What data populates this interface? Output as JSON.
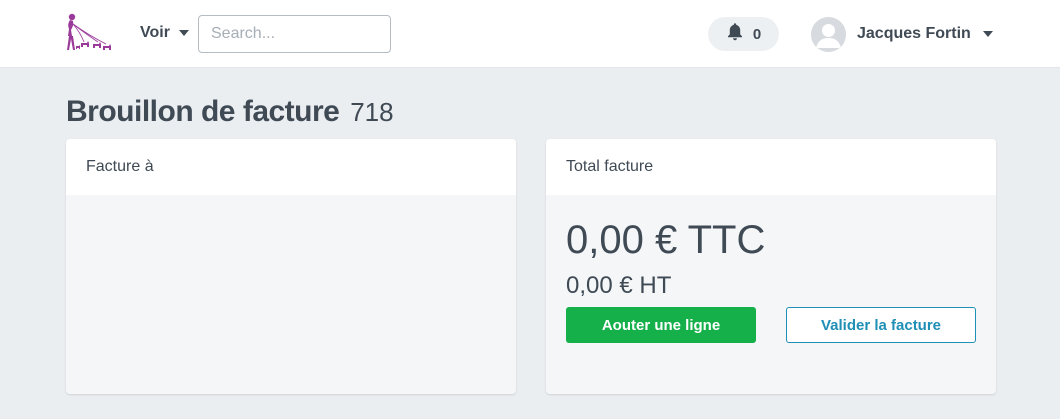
{
  "navbar": {
    "logo_icon": "dog-walker-logo-icon",
    "menu_label": "Voir",
    "search_placeholder": "Search...",
    "notifications_icon": "bell-icon",
    "notifications_count": "0",
    "user_name": "Jacques Fortin",
    "user_avatar_icon": "user-avatar-icon"
  },
  "page": {
    "title": "Brouillon de facture",
    "invoice_number": "718"
  },
  "bill_to_card": {
    "header": "Facture à"
  },
  "total_card": {
    "header": "Total facture",
    "total_ttc": "0,00 € TTC",
    "total_ht": "0,00 € HT",
    "add_line_label": "Aouter une ligne",
    "validate_label": "Valider la facture"
  },
  "colors": {
    "accent_green": "#16b04a",
    "accent_blue": "#1f8fb5",
    "logo_purple": "#9a3b9a",
    "background": "#ebeef1"
  }
}
